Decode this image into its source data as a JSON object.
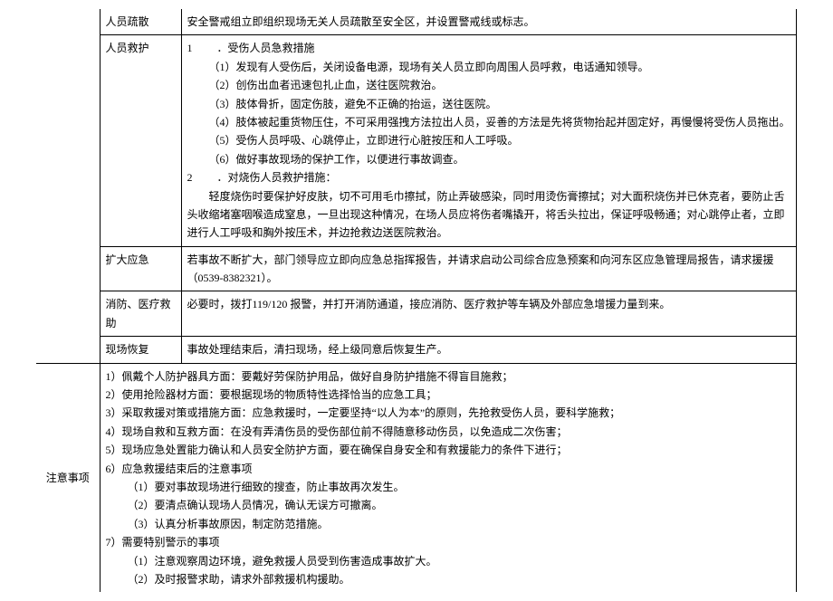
{
  "rows": {
    "evacuation": {
      "label": "人员疏散",
      "content": "安全警戒组立即组织现场无关人员疏散至安全区，并设置警戒线或标志。"
    },
    "rescue": {
      "label": "人员救护",
      "h1": "1　　 ．受伤人员急救措施",
      "h1_1": "（1）发现有人受伤后，关闭设备电源，现场有关人员立即向周围人员呼救，电话通知领导。",
      "h1_2": "（2）创伤出血者迅速包扎止血，送往医院救治。",
      "h1_3": "（3）肢体骨折，固定伤肢，避免不正确的抬运，送往医院。",
      "h1_4": "（4）肢体被起重货物压住，不可采用强拽方法拉出人员，妥善的方法是先将货物抬起并固定好，再慢慢将受伤人员拖出。",
      "h1_5": "（5）受伤人员呼吸、心跳停止，立即进行心脏按压和人工呼吸。",
      "h1_6": "（6）做好事故现场的保护工作，以便进行事故调查。",
      "h2": "2　　 ．对烧伤人员救护措施：",
      "h2_1": "　　轻度烧伤时要保护好皮肤，切不可用毛巾擦拭，防止弄破感染，同时用烫伤膏擦拭；对大面积烧伤并已休克者，要防止舌头收缩堵塞咽喉造成窒息，一旦出现这种情况，在场人员应将伤者嘴撬开，将舌头拉出，保证呼吸畅通；对心跳停止者，立即进行人工呼吸和胸外按压术，并边抢救边送医院救治。"
    },
    "escalate": {
      "label": "扩大应急",
      "content": "若事故不断扩大，部门领导应立即向应急总指挥报告，并请求启动公司综合应急预案和向河东区应急管理局报告，请求援援（0539-8382321）。"
    },
    "fire": {
      "label": "消防、医疗救助",
      "content": "必要时，拨打119/120 报警，并打开消防通道，接应消防、医疗救护等车辆及外部应急增援力量到来。"
    },
    "recover": {
      "label": "现场恢复",
      "content": "事故处理结束后，清扫现场，经上级同意后恢复生产。"
    },
    "notes": {
      "label": "注意事项",
      "n1": "1）佩戴个人防护器具方面：要戴好劳保防护用品，做好自身防护措施不得盲目施救；",
      "n2": "2）使用抢险器材方面：要根据现场的物质特性选择恰当的应急工具；",
      "n3": "3）采取救援对策或措施方面：应急救援时，一定要坚持“以人为本”的原则，先抢救受伤人员，要科学施救；",
      "n4": "4）现场自救和互救方面：在没有弄清伤员的受伤部位前不得随意移动伤员，以免造成二次伤害；",
      "n5": "5）现场应急处置能力确认和人员安全防护方面，要在确保自身安全和有救援能力的条件下进行；",
      "n6": "6）应急救援结束后的注意事项",
      "n6_1": "（1）要对事故现场进行细致的搜查，防止事故再次发生。",
      "n6_2": "（2）要清点确认现场人员情况，确认无误方可撤离。",
      "n6_3": "（3）认真分析事故原因，制定防范措施。",
      "n7": "7）需要特别警示的事项",
      "n7_1": "（1）注意观察周边环境，避免救援人员受到伤害造成事故扩大。",
      "n7_2": "（2）及时报警求助，请求外部救援机构援助。"
    }
  }
}
